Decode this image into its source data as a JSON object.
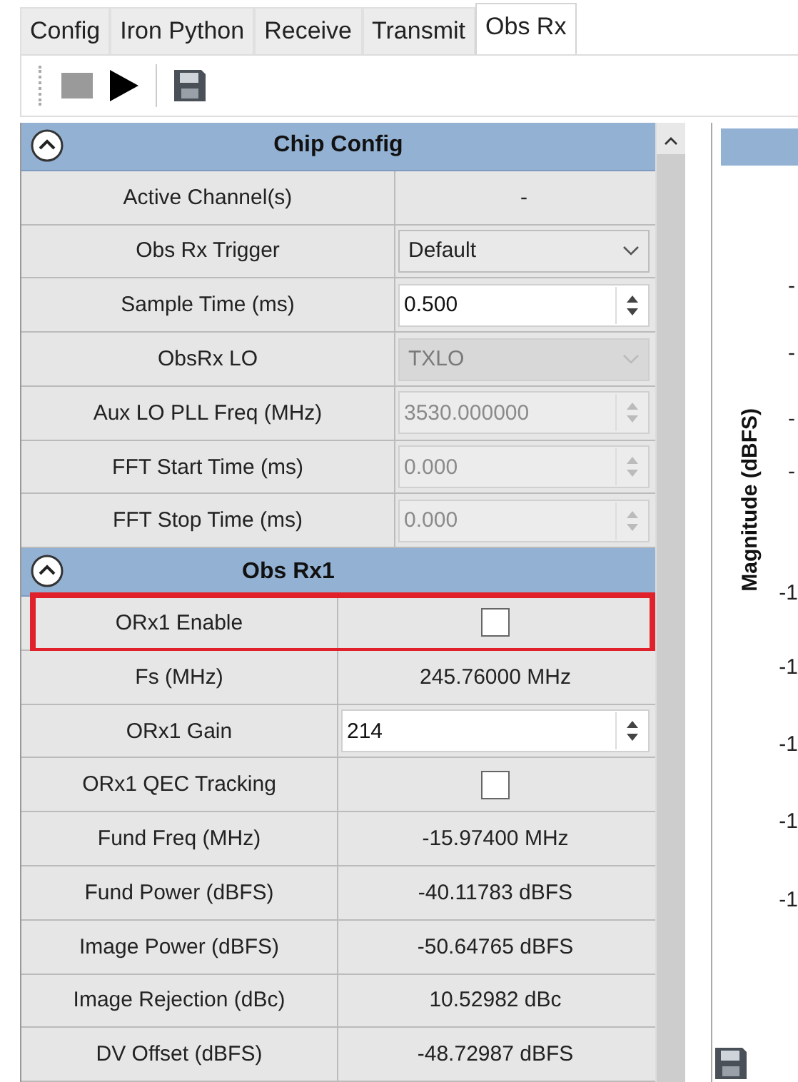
{
  "tabs": [
    {
      "label": "Config",
      "selected": false
    },
    {
      "label": "Iron Python",
      "selected": false
    },
    {
      "label": "Receive",
      "selected": false
    },
    {
      "label": "Transmit",
      "selected": false
    },
    {
      "label": "Obs Rx",
      "selected": true
    }
  ],
  "toolbar": [
    {
      "kind": "stop",
      "disabled": true
    },
    {
      "kind": "play",
      "disabled": false
    },
    {
      "kind": "separator"
    },
    {
      "kind": "save",
      "disabled": false
    }
  ],
  "sections": [
    {
      "title": "Chip Config",
      "expanded": true,
      "rows": [
        {
          "label": "Active Channel(s)",
          "kind": "text",
          "value": "-"
        },
        {
          "label": "Obs Rx Trigger",
          "kind": "dropdown",
          "value": "Default",
          "disabled": false
        },
        {
          "label": "Sample Time (ms)",
          "kind": "spinner",
          "value": "0.500",
          "disabled": false
        },
        {
          "label": "ObsRx LO",
          "kind": "dropdown",
          "value": "TXLO",
          "disabled": true
        },
        {
          "label": "Aux LO PLL Freq (MHz)",
          "kind": "spinner",
          "value": "3530.000000",
          "disabled": true
        },
        {
          "label": "FFT Start Time (ms)",
          "kind": "spinner",
          "value": "0.000",
          "disabled": true
        },
        {
          "label": "FFT Stop Time (ms)",
          "kind": "spinner",
          "value": "0.000",
          "disabled": true
        }
      ]
    },
    {
      "title": "Obs Rx1",
      "expanded": true,
      "rows": [
        {
          "label": "ORx1 Enable",
          "kind": "checkbox",
          "checked": false,
          "highlighted": true
        },
        {
          "label": "Fs (MHz)",
          "kind": "text",
          "value": "245.76000 MHz"
        },
        {
          "label": "ORx1 Gain",
          "kind": "spinner",
          "value": "214",
          "disabled": false
        },
        {
          "label": "ORx1 QEC Tracking",
          "kind": "checkbox",
          "checked": false,
          "highlighted": false
        },
        {
          "label": "Fund Freq (MHz)",
          "kind": "text",
          "value": "-15.97400 MHz"
        },
        {
          "label": "Fund Power (dBFS)",
          "kind": "text",
          "value": "-40.11783 dBFS"
        },
        {
          "label": "Image Power (dBFS)",
          "kind": "text",
          "value": "-50.64765 dBFS"
        },
        {
          "label": "Image Rejection (dBc)",
          "kind": "text",
          "value": "10.52982 dBc"
        },
        {
          "label": "DV Offset (dBFS)",
          "kind": "text",
          "value": "-48.72987 dBFS"
        }
      ]
    }
  ],
  "chart": {
    "ylabel": "Magnitude (dBFS)",
    "tick_labels": [
      "-",
      "-",
      "-",
      "-",
      "-1",
      "-1",
      "-1",
      "-1",
      "-1"
    ]
  }
}
